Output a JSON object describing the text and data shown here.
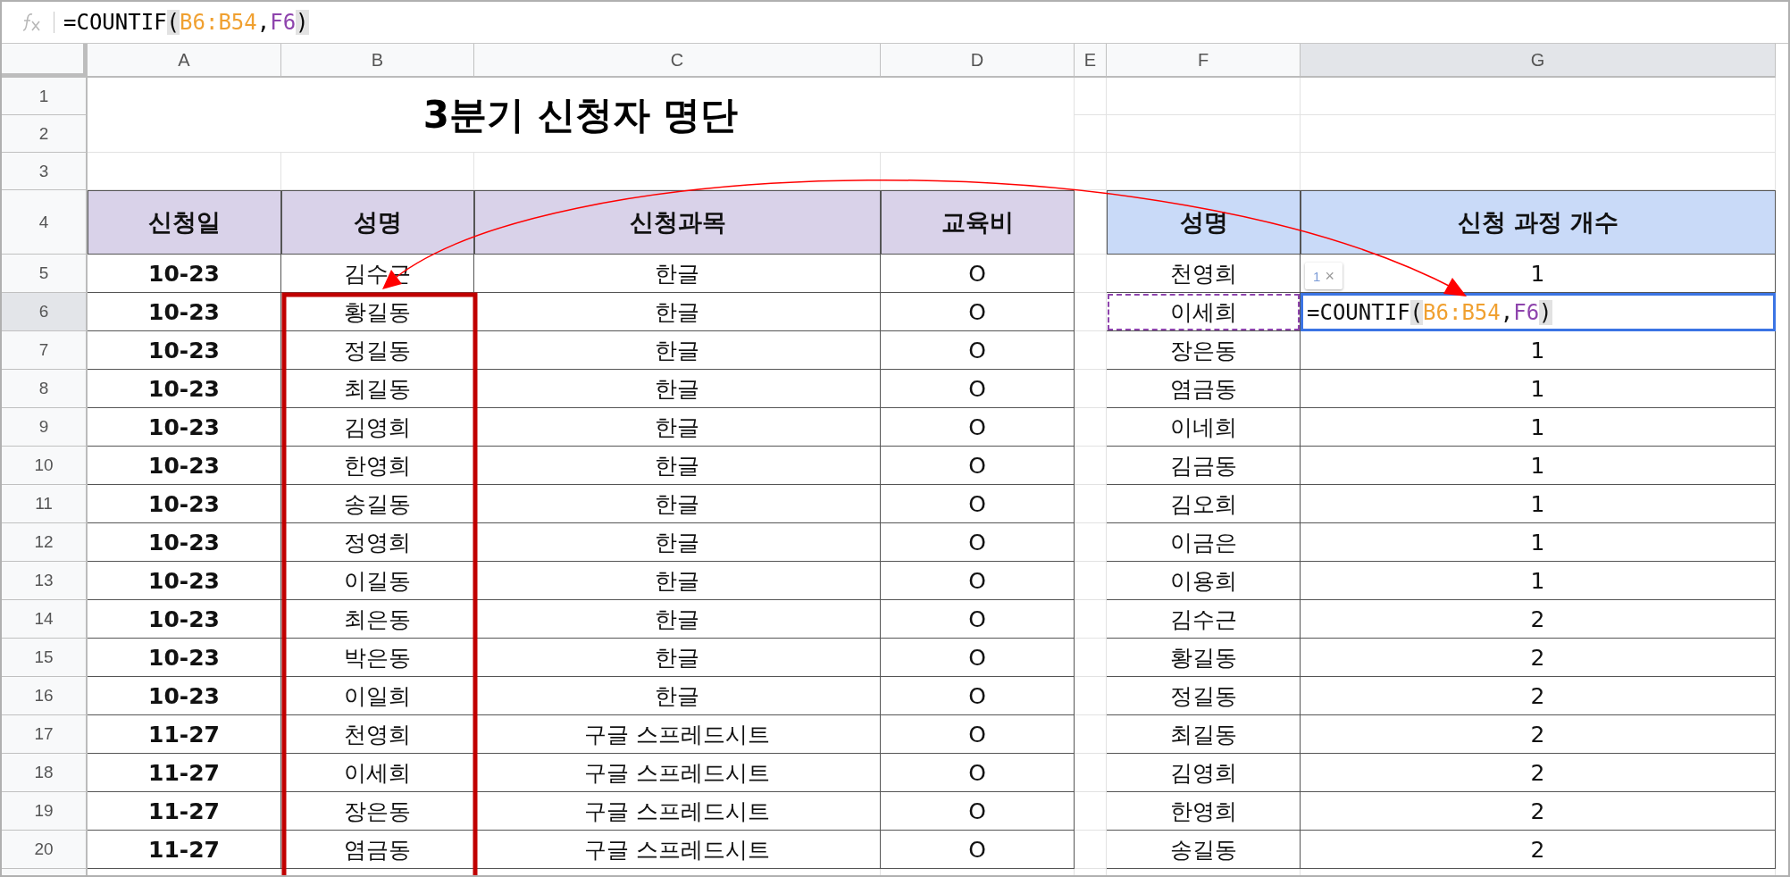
{
  "formula_bar": {
    "tokens": [
      {
        "text": "=COUNTIF",
        "kind": "plain"
      },
      {
        "text": "(",
        "kind": "paren"
      },
      {
        "text": "B6:B54",
        "kind": "range",
        "color": "#f0a030"
      },
      {
        "text": ",",
        "kind": "plain"
      },
      {
        "text": "F6",
        "kind": "range",
        "color": "#8e44ad"
      },
      {
        "text": ")",
        "kind": "paren"
      }
    ]
  },
  "columns": [
    {
      "label": "A",
      "selected": false
    },
    {
      "label": "B",
      "selected": false
    },
    {
      "label": "C",
      "selected": false
    },
    {
      "label": "D",
      "selected": false
    },
    {
      "label": "E",
      "selected": false
    },
    {
      "label": "F",
      "selected": false
    },
    {
      "label": "G",
      "selected": true
    }
  ],
  "row_headers": [
    {
      "label": "1",
      "selected": false
    },
    {
      "label": "2",
      "selected": false
    },
    {
      "label": "3",
      "selected": false
    },
    {
      "label": "4",
      "selected": false
    },
    {
      "label": "5",
      "selected": false
    },
    {
      "label": "6",
      "selected": true
    },
    {
      "label": "7",
      "selected": false
    },
    {
      "label": "8",
      "selected": false
    },
    {
      "label": "9",
      "selected": false
    },
    {
      "label": "10",
      "selected": false
    },
    {
      "label": "11",
      "selected": false
    },
    {
      "label": "12",
      "selected": false
    },
    {
      "label": "13",
      "selected": false
    },
    {
      "label": "14",
      "selected": false
    },
    {
      "label": "15",
      "selected": false
    },
    {
      "label": "16",
      "selected": false
    },
    {
      "label": "17",
      "selected": false
    },
    {
      "label": "18",
      "selected": false
    },
    {
      "label": "19",
      "selected": false
    },
    {
      "label": "20",
      "selected": false
    }
  ],
  "title": "3분기 신청자 명단",
  "left_table": {
    "headers": [
      "신청일",
      "성명",
      "신청과목",
      "교육비"
    ],
    "rows": [
      [
        "10-23",
        "김수근",
        "한글",
        "O"
      ],
      [
        "10-23",
        "황길동",
        "한글",
        "O"
      ],
      [
        "10-23",
        "정길동",
        "한글",
        "O"
      ],
      [
        "10-23",
        "최길동",
        "한글",
        "O"
      ],
      [
        "10-23",
        "김영희",
        "한글",
        "O"
      ],
      [
        "10-23",
        "한영희",
        "한글",
        "O"
      ],
      [
        "10-23",
        "송길동",
        "한글",
        "O"
      ],
      [
        "10-23",
        "정영희",
        "한글",
        "O"
      ],
      [
        "10-23",
        "이길동",
        "한글",
        "O"
      ],
      [
        "10-23",
        "최은동",
        "한글",
        "O"
      ],
      [
        "10-23",
        "박은동",
        "한글",
        "O"
      ],
      [
        "10-23",
        "이일희",
        "한글",
        "O"
      ],
      [
        "11-27",
        "천영희",
        "구글 스프레드시트",
        "O"
      ],
      [
        "11-27",
        "이세희",
        "구글 스프레드시트",
        "O"
      ],
      [
        "11-27",
        "장은동",
        "구글 스프레드시트",
        "O"
      ],
      [
        "11-27",
        "염금동",
        "구글 스프레드시트",
        "O"
      ]
    ]
  },
  "right_table": {
    "headers": [
      "성명",
      "신청 과정 개수"
    ],
    "rows": [
      {
        "name": "천영희",
        "count": "1",
        "referenced": false,
        "editing": false
      },
      {
        "name": "이세희",
        "referenced": true,
        "editing": true,
        "formula": [
          {
            "text": "=COUNTIF",
            "kind": "plain"
          },
          {
            "text": "(",
            "kind": "paren"
          },
          {
            "text": "B6:B54",
            "kind": "range",
            "color": "#f0a030"
          },
          {
            "text": ",",
            "kind": "plain"
          },
          {
            "text": "F6",
            "kind": "range",
            "color": "#8e44ad"
          },
          {
            "text": ")",
            "kind": "paren"
          }
        ]
      },
      {
        "name": "장은동",
        "count": "1",
        "referenced": false,
        "editing": false
      },
      {
        "name": "염금동",
        "count": "1",
        "referenced": false,
        "editing": false
      },
      {
        "name": "이네희",
        "count": "1",
        "referenced": false,
        "editing": false
      },
      {
        "name": "김금동",
        "count": "1",
        "referenced": false,
        "editing": false
      },
      {
        "name": "김오희",
        "count": "1",
        "referenced": false,
        "editing": false
      },
      {
        "name": "이금은",
        "count": "1",
        "referenced": false,
        "editing": false
      },
      {
        "name": "이용희",
        "count": "1",
        "referenced": false,
        "editing": false
      },
      {
        "name": "김수근",
        "count": "2",
        "referenced": false,
        "editing": false
      },
      {
        "name": "황길동",
        "count": "2",
        "referenced": false,
        "editing": false
      },
      {
        "name": "정길동",
        "count": "2",
        "referenced": false,
        "editing": false
      },
      {
        "name": "최길동",
        "count": "2",
        "referenced": false,
        "editing": false
      },
      {
        "name": "김영희",
        "count": "2",
        "referenced": false,
        "editing": false
      },
      {
        "name": "한영희",
        "count": "2",
        "referenced": false,
        "editing": false
      },
      {
        "name": "송길동",
        "count": "2",
        "referenced": false,
        "editing": false
      }
    ]
  },
  "tooltip": {
    "count": "1",
    "close": "×"
  }
}
